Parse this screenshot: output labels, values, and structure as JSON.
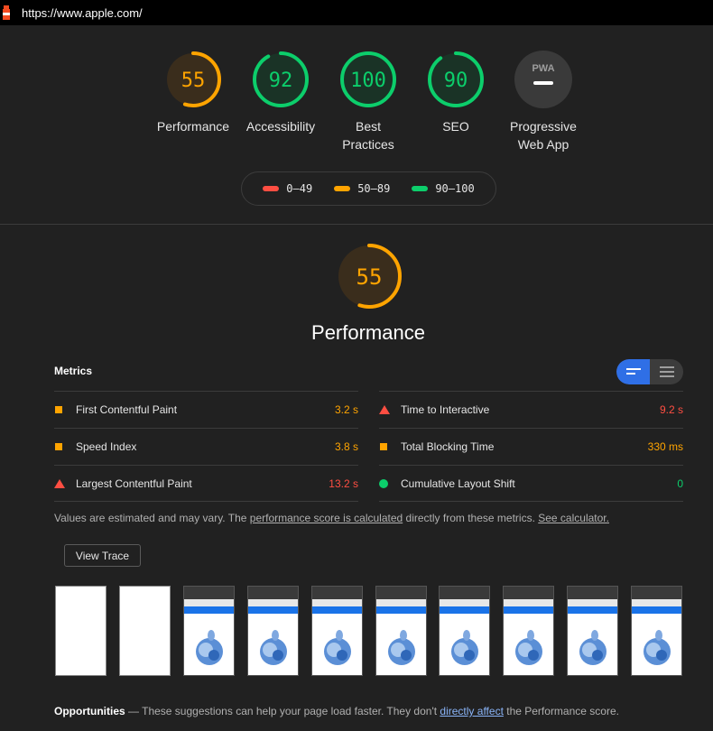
{
  "topbar": {
    "url": "https://www.apple.com/"
  },
  "colors": {
    "fail": "#ff4e42",
    "average": "#ffa400",
    "pass": "#0cce6b",
    "accent": "#2f6fe6"
  },
  "categories": [
    {
      "score": "55",
      "label": "Performance",
      "value": 0.55,
      "status": "average"
    },
    {
      "score": "92",
      "label": "Accessibility",
      "value": 0.92,
      "status": "pass"
    },
    {
      "score": "100",
      "label": "Best Practices",
      "value": 1.0,
      "status": "pass"
    },
    {
      "score": "90",
      "label": "SEO",
      "value": 0.9,
      "status": "pass"
    },
    {
      "score": "PWA",
      "label": "Progressive Web App",
      "status": "neutral"
    }
  ],
  "legend": [
    {
      "label": "0–49",
      "status": "fail"
    },
    {
      "label": "50–89",
      "status": "average"
    },
    {
      "label": "90–100",
      "status": "pass"
    }
  ],
  "performance": {
    "score": "55",
    "value": 0.55,
    "title": "Performance"
  },
  "metrics": {
    "header": "Metrics",
    "items": [
      {
        "name": "First Contentful Paint",
        "value": "3.2 s",
        "status": "average",
        "icon": "square-icon"
      },
      {
        "name": "Time to Interactive",
        "value": "9.2 s",
        "status": "fail",
        "icon": "triangle-icon"
      },
      {
        "name": "Speed Index",
        "value": "3.8 s",
        "status": "average",
        "icon": "square-icon"
      },
      {
        "name": "Total Blocking Time",
        "value": "330 ms",
        "status": "average",
        "icon": "square-icon"
      },
      {
        "name": "Largest Contentful Paint",
        "value": "13.2 s",
        "status": "fail",
        "icon": "triangle-icon"
      },
      {
        "name": "Cumulative Layout Shift",
        "value": "0",
        "status": "pass",
        "icon": "circle-icon"
      }
    ]
  },
  "note": {
    "pre": "Values are estimated and may vary. The ",
    "link1": "performance score is calculated",
    "mid": " directly from these metrics. ",
    "link2": "See calculator."
  },
  "view_trace": "View Trace",
  "opportunities": {
    "title": "Opportunities",
    "dash": " — ",
    "pre": "These suggestions can help your page load faster. They don't ",
    "link": "directly affect",
    "post": " the Performance score."
  }
}
